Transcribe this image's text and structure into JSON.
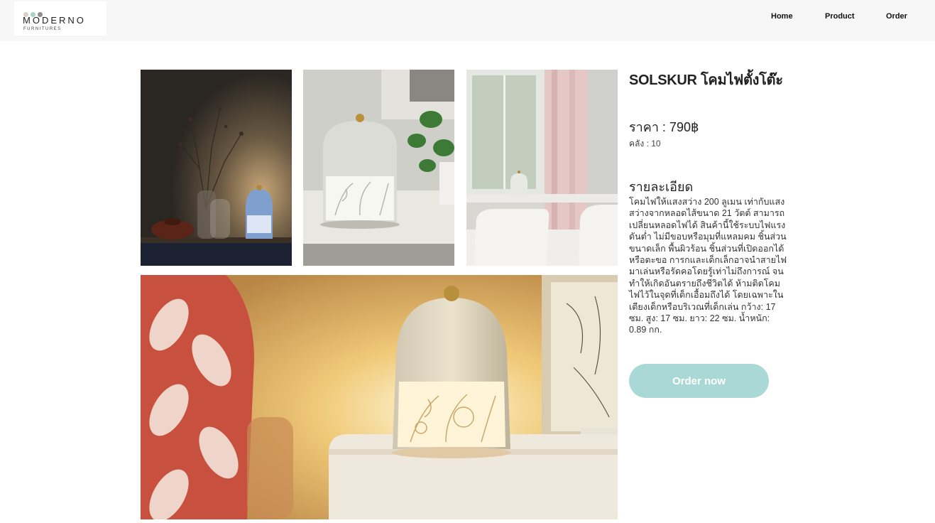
{
  "header": {
    "logo": {
      "brand": "MODERNO",
      "sub": "FURNITURES",
      "dot_colors": [
        "#d9d0c6",
        "#a9d3c9",
        "#8e8e8e"
      ]
    },
    "nav": [
      {
        "label": "Home"
      },
      {
        "label": "Product"
      },
      {
        "label": "Order"
      }
    ]
  },
  "gallery": {
    "images": [
      {
        "alt": "lamp on dark shelf with vase"
      },
      {
        "alt": "white lamp close-up with plant"
      },
      {
        "alt": "lamp by window in room"
      },
      {
        "alt": "glowing lamp on bedside table"
      }
    ]
  },
  "product": {
    "title": "SOLSKUR โคมไฟตั้งโต๊ะ",
    "price": "ราคา : 790฿",
    "stock": "คลัง : 10",
    "detail_heading": "รายละเอียด",
    "detail_text": "โคมไฟให้แสงสว่าง 200 ลูเมน เท่ากับแสงสว่างจากหลอดไส้ขนาด 21 วัตต์ สามารถเปลี่ยนหลอดไฟได้ สินค้านี้ใช้ระบบไฟแรงดันต่ำ ไม่มีขอบหรือมุมที่แหลมคม ชิ้นส่วนขนาดเล็ก พื้นผิวร้อน ชิ้นส่วนที่เปิดออกได้ หรือตะขอ การกและเด็กเล็กอาจนำสายไฟมาเล่นหรือรัดคอโดยรู้เท่าไม่ถึงการณ์ จนทำให้เกิดอันตรายถึงชีวิตได้ ห้ามติดโคมไฟไว้ในจุดที่เด็กเอื้อมถึงได้ โดยเฉพาะในเตียงเด็กหรือบริเวณที่เด็กเล่น กว้าง: 17 ซม. สูง: 17 ซม. ยาว: 22 ซม. น้ำหนัก: 0.89 กก.",
    "order_button": "Order now"
  },
  "colors": {
    "accent": "#a9d8d6",
    "header_bg": "#f7f7f8"
  }
}
